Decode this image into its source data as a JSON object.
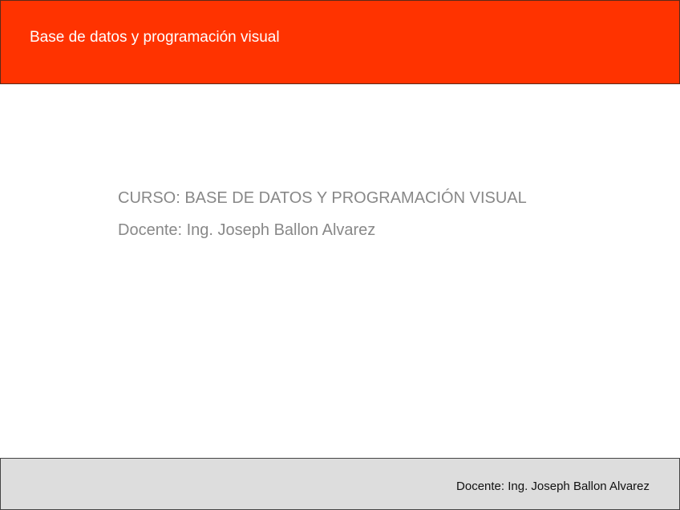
{
  "header": {
    "title": "Base de datos y programación visual"
  },
  "content": {
    "course": "CURSO: BASE DE DATOS Y PROGRAMACIÓN VISUAL",
    "teacher": "Docente: Ing. Joseph Ballon Alvarez"
  },
  "footer": {
    "text": "Docente: Ing. Joseph Ballon Alvarez"
  },
  "colors": {
    "header_bg": "#ff3300",
    "footer_bg": "#dddddd",
    "body_text": "#888888"
  }
}
